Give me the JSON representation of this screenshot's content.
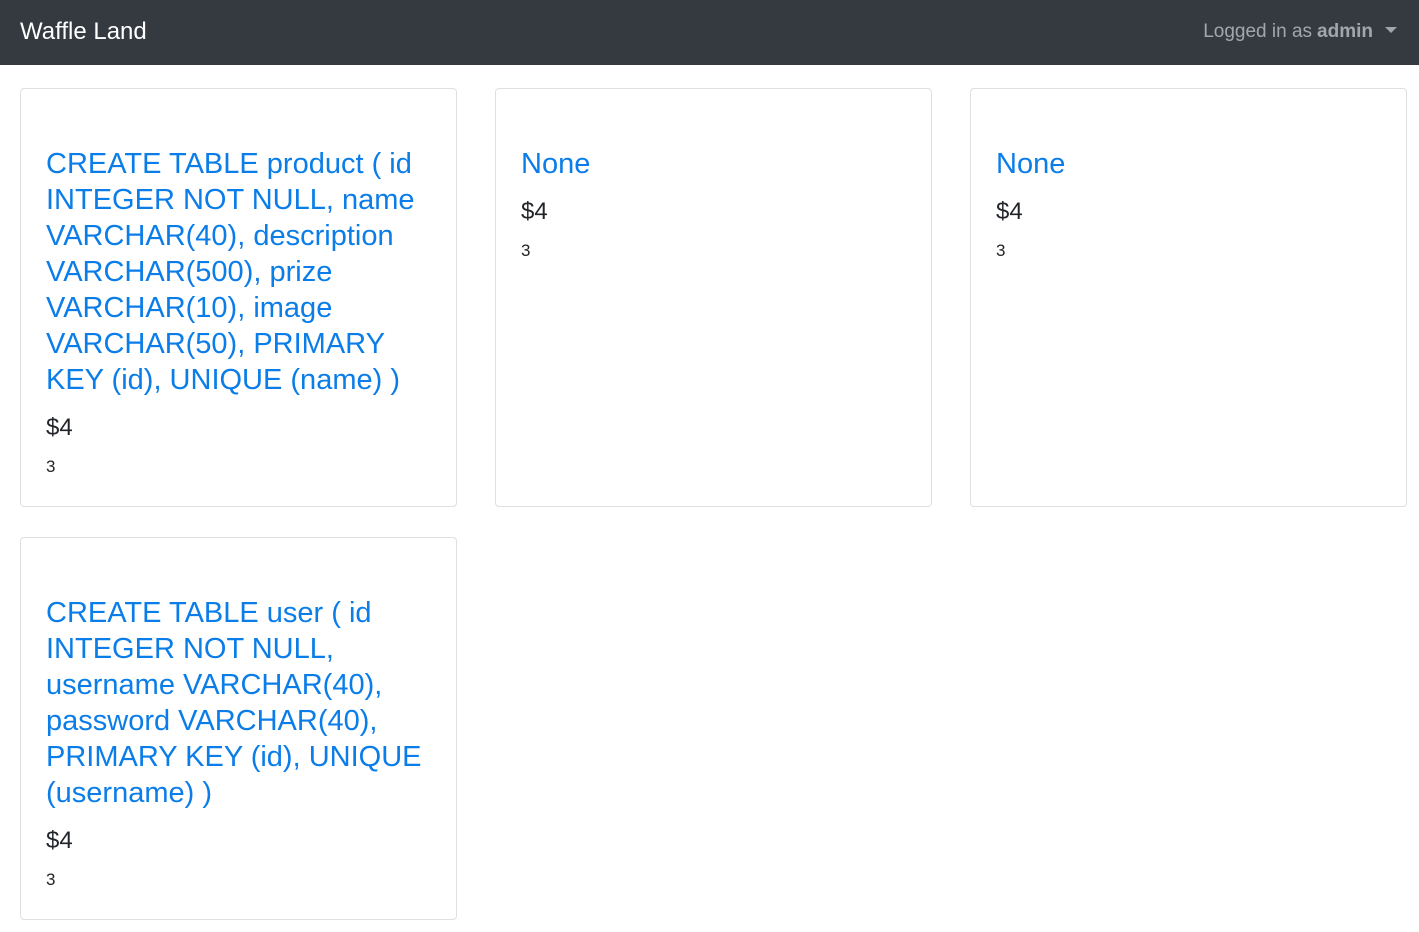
{
  "navbar": {
    "brand": "Waffle Land",
    "user_prefix": "Logged in as",
    "username": "admin"
  },
  "cards": [
    {
      "title": "CREATE TABLE product ( id INTEGER NOT NULL, name VARCHAR(40), description VARCHAR(500), prize VARCHAR(10), image VARCHAR(50), PRIMARY KEY (id), UNIQUE (name) )",
      "price": "$4",
      "quantity": "3"
    },
    {
      "title": "None",
      "price": "$4",
      "quantity": "3"
    },
    {
      "title": "None",
      "price": "$4",
      "quantity": "3"
    },
    {
      "title": "CREATE TABLE user ( id INTEGER NOT NULL, username VARCHAR(40), password VARCHAR(40), PRIMARY KEY (id), UNIQUE (username) )",
      "price": "$4",
      "quantity": "3"
    }
  ]
}
